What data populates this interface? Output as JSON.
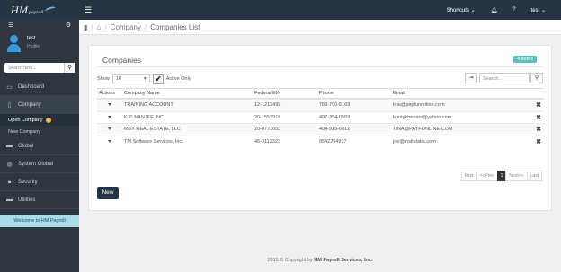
{
  "app": {
    "logo_text": "HM",
    "logo_sub": "payroll",
    "shortcuts_label": "Shortcuts",
    "help_label": "?",
    "user_menu_label": "test"
  },
  "sidebar": {
    "user_name": "test",
    "user_role": "Profile",
    "search_placeholder": "Search here...",
    "items": [
      {
        "label": "Dashboard",
        "icon": "monitor-icon"
      },
      {
        "label": "Company",
        "icon": "document-icon"
      },
      {
        "label": "Global",
        "icon": "folder-icon"
      },
      {
        "label": "System Global",
        "icon": "globe-icon"
      },
      {
        "label": "Security",
        "icon": "lock-icon"
      },
      {
        "label": "Utilities",
        "icon": "folder-open-icon"
      }
    ],
    "company_sub": [
      {
        "label": "Open Company",
        "badge": "!"
      },
      {
        "label": "New Company"
      }
    ],
    "welcome": "Welcome to HM Payroll"
  },
  "breadcrumb": {
    "items": [
      "Company",
      "Companies List"
    ]
  },
  "panel": {
    "title": "Companies",
    "count_badge": "4 items",
    "show_label": "Show",
    "show_value": "10",
    "active_only_label": "Active Only",
    "search_placeholder": "Search..."
  },
  "table": {
    "headers": [
      "Actions",
      "Company Name",
      "Federal EIN",
      "Phone",
      "Email"
    ],
    "rows": [
      {
        "name": "TRAINING ACCOUNT",
        "ein": "12-1212499",
        "phone": "788-700-5169",
        "email": "tina@payfunonline.com"
      },
      {
        "name": "K.P. NANJEE INC",
        "ein": "20-1553916",
        "phone": "407-354-0559",
        "email": "buntykhenani@yahoo.com"
      },
      {
        "name": "MSY REAL ESTATE, LLC",
        "ein": "20-8773653",
        "phone": "404-915-6012",
        "email": "TINA@PAYFONLINE.COM"
      },
      {
        "name": "TM Software Services, Inc.",
        "ein": "46-3112323",
        "phone": "8542294937",
        "email": "joe@insitelabs.com"
      }
    ]
  },
  "pager": {
    "first": "First",
    "prev": "<<Prev",
    "current": "1",
    "next": "Next>>",
    "last": "Last"
  },
  "new_button": "New",
  "footer": {
    "prefix": "2015 © Copyright by ",
    "company": "HM Payroll Services, Inc."
  }
}
